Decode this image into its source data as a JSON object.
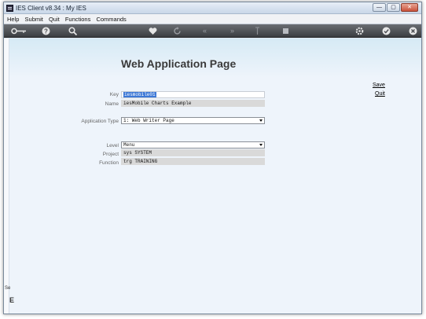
{
  "window": {
    "title": "IES Client v8.34 : My IES"
  },
  "window_buttons": {
    "minimize": "—",
    "maximize": "▢",
    "close": "✕"
  },
  "menu": [
    "Help",
    "Submit",
    "Quit",
    "Functions",
    "Commands"
  ],
  "toolbar_icons": [
    "key-icon",
    "help-icon",
    "search-icon",
    "heart-icon",
    "refresh-icon",
    "back-icon",
    "forward-icon",
    "upload-icon",
    "square-icon",
    "settings-icon",
    "check-icon",
    "close-icon"
  ],
  "page": {
    "title": "Web Application Page"
  },
  "actions": {
    "save": "Save",
    "quit": "Quit"
  },
  "form": {
    "key_label": "Key",
    "key_value": "iesmobile01",
    "name_label": "Name",
    "name_value": "iesMobile Charts Example",
    "apptype_label": "Application Type",
    "apptype_value": "1: Web Writer Page",
    "level_label": "Level",
    "level_value": "Menu",
    "project_label": "Project",
    "project_value": "sys SYSTEM",
    "function_label": "Function",
    "function_value": "trg TRAINING"
  },
  "bottom_left": {
    "frag1": "Se",
    "frag2": "E"
  }
}
